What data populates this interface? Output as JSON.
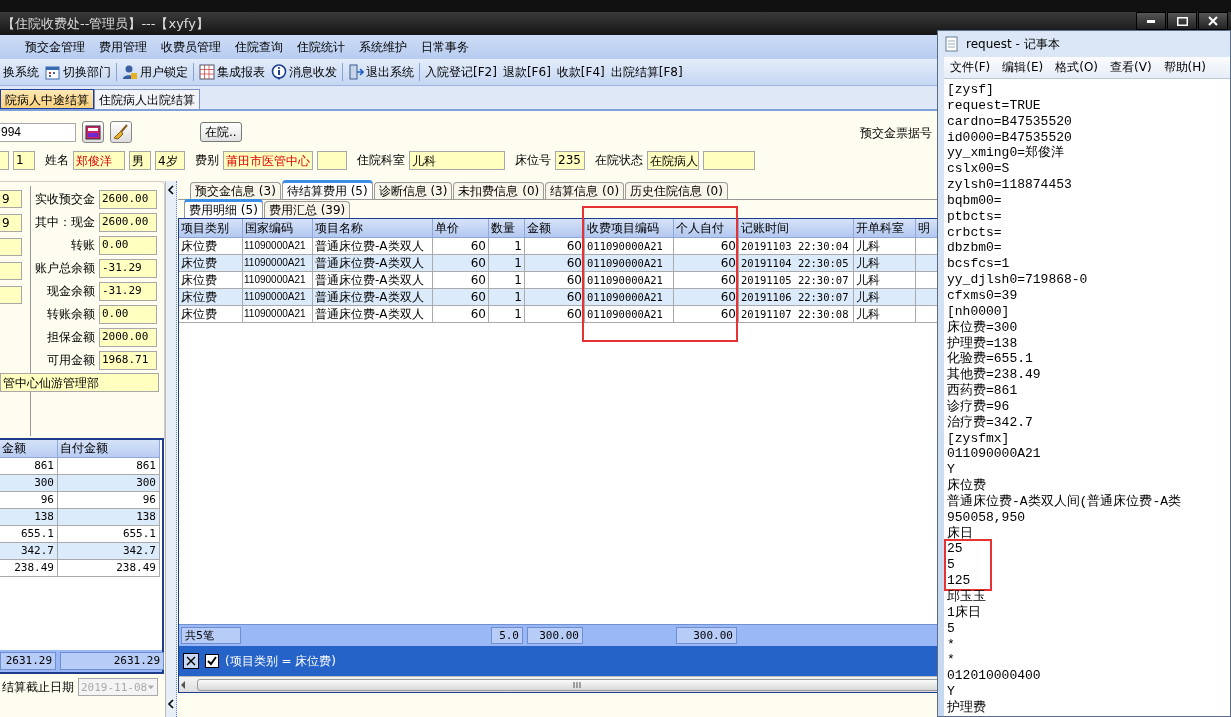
{
  "app": {
    "title": "【住院收费处--管理员】---【xyfy】",
    "menu": [
      "预交金管理",
      "费用管理",
      "收费员管理",
      "住院查询",
      "住院统计",
      "系统维护",
      "日常事务"
    ],
    "toolbar": [
      [
        {
          "label": "换系统",
          "kind": "text"
        },
        {
          "label": "切换部门",
          "kind": "calendar"
        }
      ],
      [
        {
          "label": "用户锁定",
          "kind": "user"
        }
      ],
      [
        {
          "label": "集成报表",
          "kind": "grid"
        },
        {
          "label": "消息收发",
          "kind": "info"
        }
      ],
      [
        {
          "label": "退出系统",
          "kind": "exit"
        }
      ],
      [
        {
          "label": "入院登记[F2]",
          "kind": "text"
        },
        {
          "label": "退款[F6]",
          "kind": "text"
        },
        {
          "label": "收款[F4]",
          "kind": "text"
        },
        {
          "label": "出院结算[F8]",
          "kind": "text"
        }
      ]
    ],
    "tabs": [
      {
        "label": "院病人中途结算",
        "selected": true
      },
      {
        "label": "住院病人出院结算",
        "selected": false
      }
    ],
    "card_field": {
      "value": "994"
    },
    "status_button": "在院..",
    "receipt_label": "预交金票据号",
    "patient_fields": [
      {
        "kind": "blank"
      },
      {
        "kind": "text",
        "value": "1"
      },
      {
        "kind": "text",
        "label": "姓名",
        "value": "郑俊洋",
        "alert": true
      },
      {
        "kind": "text",
        "value": "男"
      },
      {
        "kind": "text",
        "value": "4岁"
      },
      {
        "kind": "text",
        "label": "费别",
        "value": "莆田市医管中心",
        "alert": true
      },
      {
        "kind": "blank"
      },
      {
        "kind": "text",
        "label": "住院科室",
        "value": "儿科",
        "alert": false
      },
      {
        "kind": "text",
        "label": "床位号",
        "value": "235",
        "alert": false
      },
      {
        "kind": "text",
        "label": "在院状态",
        "value": "在院病人",
        "alert": false
      },
      {
        "kind": "blank"
      }
    ],
    "side_fields": [
      {
        "kind": "text",
        "value": "9"
      },
      {
        "kind": "text",
        "value": "9"
      },
      {
        "kind": "blank"
      },
      {
        "kind": "blank"
      },
      {
        "kind": "blank"
      }
    ],
    "money_fields": [
      {
        "label": "实收预交金",
        "value": "2600.00"
      },
      {
        "label": "其中：现金",
        "value": "2600.00"
      },
      {
        "label": "转账",
        "value": "0.00"
      },
      {
        "label": "账户总余额",
        "value": "-31.29"
      },
      {
        "label": "现金余额",
        "value": "-31.29"
      },
      {
        "label": "转账余额",
        "value": "0.00"
      },
      {
        "label": "担保金额",
        "value": "2000.00"
      },
      {
        "label": "可用金额",
        "value": "1968.71"
      }
    ],
    "address_field": "管中心仙游管理部",
    "summary_table": {
      "columns": [
        "金额",
        "自付金额"
      ],
      "rows": [
        [
          "861",
          "861"
        ],
        [
          "300",
          "300"
        ],
        [
          "96",
          "96"
        ],
        [
          "138",
          "138"
        ],
        [
          "655.1",
          "655.1"
        ],
        [
          "342.7",
          "342.7"
        ],
        [
          "238.49",
          "238.49"
        ]
      ],
      "totals": [
        "2631.29",
        "2631.29"
      ]
    },
    "settle_date": {
      "label": "结算截止日期",
      "value": "2019-11-08",
      "disabled": true
    },
    "detail_tabs": [
      {
        "label": "预交金信息 (3)",
        "selected": false
      },
      {
        "label": "待结算费用 (5)",
        "selected": true
      },
      {
        "label": "诊断信息 (3)",
        "selected": false
      },
      {
        "label": "未扣费信息 (0)",
        "selected": false
      },
      {
        "label": "结算信息 (0)",
        "selected": false
      },
      {
        "label": "历史住院信息 (0)",
        "selected": false
      }
    ],
    "sub_tabs": [
      {
        "label": "费用明细 (5)",
        "selected": true
      },
      {
        "label": "费用汇总 (39)",
        "selected": false
      }
    ],
    "grid": {
      "column_groups": [
        {
          "highlighted": false,
          "columns": [
            "项目类别",
            "国家编码",
            "项目名称",
            "单价",
            "数量",
            "金额"
          ]
        },
        {
          "highlighted": true,
          "columns": [
            "收费项目编码",
            "个人自付"
          ]
        },
        {
          "highlighted": false,
          "columns": [
            "记账时间",
            "开单科室",
            "明"
          ]
        }
      ],
      "rows": [
        [
          "床位费",
          "11090000A21",
          "普通床位费-A类双人",
          "60",
          "1",
          "60",
          "011090000A21",
          "60",
          "20191103 22:30:04",
          "儿科"
        ],
        [
          "床位费",
          "11090000A21",
          "普通床位费-A类双人",
          "60",
          "1",
          "60",
          "011090000A21",
          "60",
          "20191104 22:30:05",
          "儿科"
        ],
        [
          "床位费",
          "11090000A21",
          "普通床位费-A类双人",
          "60",
          "1",
          "60",
          "011090000A21",
          "60",
          "20191105 22:30:07",
          "儿科"
        ],
        [
          "床位费",
          "11090000A21",
          "普通床位费-A类双人",
          "60",
          "1",
          "60",
          "011090000A21",
          "60",
          "20191106 22:30:07",
          "儿科"
        ],
        [
          "床位费",
          "11090000A21",
          "普通床位费-A类双人",
          "60",
          "1",
          "60",
          "011090000A21",
          "60",
          "20191107 22:30:08",
          "儿科"
        ]
      ],
      "footer": [
        "共5笔",
        "5.0",
        "300.00",
        "300.00"
      ],
      "filter": {
        "enabled": true,
        "text": "(项目类别 = 床位费)"
      }
    }
  },
  "notepad": {
    "title": "request - 记事本",
    "menu": [
      "文件(F)",
      "编辑(E)",
      "格式(O)",
      "查看(V)",
      "帮助(H)"
    ],
    "blocks": [
      {
        "highlighted": false,
        "lines": [
          "[zysf]",
          "request=TRUE",
          "cardno=B47535520",
          "id0000=B47535520",
          "yy_xming0=郑俊洋",
          "cslx00=S",
          "zylsh0=118874453",
          "bqbm00=",
          "ptbcts=",
          "crbcts=",
          "dbzbm0=",
          "bcsfcs=1",
          "yy_djlsh0=719868-0",
          "cfxms0=39",
          "[nh0000]",
          "床位费=300",
          "护理费=138",
          "化验费=655.1",
          "其他费=238.49",
          "西药费=861",
          "诊疗费=96",
          "治疗费=342.7",
          "[zysfmx]",
          "011090000A21",
          "Y",
          "床位费",
          "普通床位费-A类双人间(普通床位费-A类",
          "950058,950",
          "床日"
        ]
      },
      {
        "highlighted": true,
        "lines": [
          "25",
          "5",
          "125"
        ]
      },
      {
        "highlighted": false,
        "lines": [
          "邱玉玉",
          "1床日",
          "5",
          "*",
          "*",
          "012010000400",
          "Y",
          "护理费"
        ]
      }
    ]
  }
}
